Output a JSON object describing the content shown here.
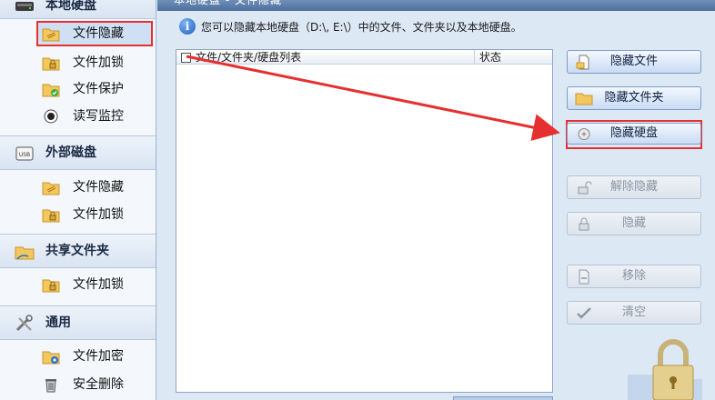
{
  "sidebar": {
    "groups": [
      {
        "title": "本地硬盘",
        "icon": "local-disk-icon",
        "items": [
          {
            "label": "文件隐藏",
            "icon": "folder-hide-icon",
            "selected": true
          },
          {
            "label": "文件加锁",
            "icon": "folder-lock-icon"
          },
          {
            "label": "文件保护",
            "icon": "folder-protect-icon"
          },
          {
            "label": "读写监控",
            "icon": "monitor-icon"
          }
        ]
      },
      {
        "title": "外部磁盘",
        "icon": "usb-disk-icon",
        "items": [
          {
            "label": "文件隐藏",
            "icon": "folder-hide-icon"
          },
          {
            "label": "文件加锁",
            "icon": "folder-lock-icon"
          }
        ]
      },
      {
        "title": "共享文件夹",
        "icon": "shared-folder-icon",
        "items": [
          {
            "label": "文件加锁",
            "icon": "folder-lock-icon"
          }
        ]
      },
      {
        "title": "通用",
        "icon": "tools-icon",
        "items": [
          {
            "label": "文件加密",
            "icon": "folder-encrypt-icon"
          },
          {
            "label": "安全删除",
            "icon": "trash-icon"
          }
        ]
      }
    ]
  },
  "main": {
    "breadcrumb": "本地硬盘 - 文件隐藏",
    "info_text": "您可以隐藏本地硬盘（D:\\, E:\\）中的文件、文件夹以及本地硬盘。",
    "list": {
      "columns": [
        "文件/文件夹/硬盘列表",
        "状态"
      ],
      "rows": []
    },
    "buttons": {
      "hide_file": "隐藏文件",
      "hide_folder": "隐藏文件夹",
      "hide_disk": "隐藏硬盘",
      "unhide": "解除隐藏",
      "hide": "隐藏",
      "remove": "移除",
      "clear": "清空"
    }
  },
  "colors": {
    "highlight_red": "#e63030",
    "panel_blue": "#dde8f5",
    "button_border": "#7f9dc6"
  }
}
